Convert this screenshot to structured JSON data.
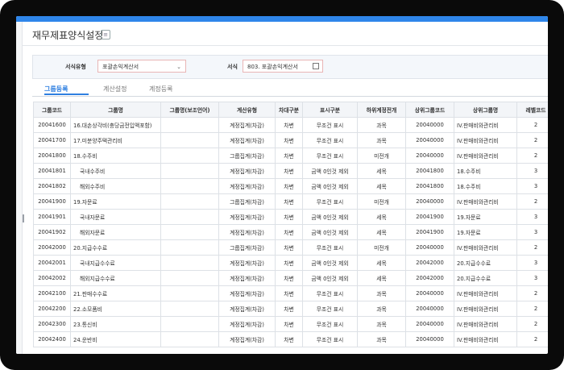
{
  "page_title": "재무제표양식설정",
  "filter": {
    "type_label": "서식유형",
    "type_value": "포괄손익계산서",
    "form_label": "서식",
    "form_value": "803. 포괄손익계산서"
  },
  "tabs": [
    "그룹등록",
    "계산설정",
    "계정등록"
  ],
  "columns": [
    "그룹코드",
    "그룹명",
    "그룹명(보조언어)",
    "계산유형",
    "차대구분",
    "표시구분",
    "하위계정전개",
    "상위그룹코드",
    "상위그룹명",
    "레벨코드"
  ],
  "rows": [
    {
      "code": "20041600",
      "name": "16.대손상각비(충당금전입액포함)",
      "sub": "",
      "calc": "계정집계(차감)",
      "dc": "차변",
      "disp": "무조건 표시",
      "expand": "과목",
      "pcode": "20040000",
      "pname": "IV.판매비와관리비",
      "level": "2",
      "indent": false
    },
    {
      "code": "20041700",
      "name": "17.미분양주택관리비",
      "sub": "",
      "calc": "계정집계(차감)",
      "dc": "차변",
      "disp": "무조건 표시",
      "expand": "과목",
      "pcode": "20040000",
      "pname": "IV.판매비와관리비",
      "level": "2",
      "indent": false
    },
    {
      "code": "20041800",
      "name": "18.수주비",
      "sub": "",
      "calc": "그룹집계(차감)",
      "dc": "차변",
      "disp": "무조건 표시",
      "expand": "미전개",
      "pcode": "20040000",
      "pname": "IV.판매비와관리비",
      "level": "2",
      "indent": false
    },
    {
      "code": "20041801",
      "name": "국내수주비",
      "sub": "",
      "calc": "계정집계(차감)",
      "dc": "차변",
      "disp": "금액 0인것 제외",
      "expand": "세목",
      "pcode": "20041800",
      "pname": "18.수주비",
      "level": "3",
      "indent": true
    },
    {
      "code": "20041802",
      "name": "해외수주비",
      "sub": "",
      "calc": "계정집계(차감)",
      "dc": "차변",
      "disp": "금액 0인것 제외",
      "expand": "세목",
      "pcode": "20041800",
      "pname": "18.수주비",
      "level": "3",
      "indent": true
    },
    {
      "code": "20041900",
      "name": "19.자문료",
      "sub": "",
      "calc": "그룹집계(차감)",
      "dc": "차변",
      "disp": "무조건 표시",
      "expand": "미전개",
      "pcode": "20040000",
      "pname": "IV.판매비와관리비",
      "level": "2",
      "indent": false
    },
    {
      "code": "20041901",
      "name": "국내자문료",
      "sub": "",
      "calc": "계정집계(차감)",
      "dc": "차변",
      "disp": "금액 0인것 제외",
      "expand": "세목",
      "pcode": "20041900",
      "pname": "19.자문료",
      "level": "3",
      "indent": true
    },
    {
      "code": "20041902",
      "name": "해외자문료",
      "sub": "",
      "calc": "계정집계(차감)",
      "dc": "차변",
      "disp": "금액 0인것 제외",
      "expand": "세목",
      "pcode": "20041900",
      "pname": "19.자문료",
      "level": "3",
      "indent": true
    },
    {
      "code": "20042000",
      "name": "20.지급수수료",
      "sub": "",
      "calc": "그룹집계(차감)",
      "dc": "차변",
      "disp": "무조건 표시",
      "expand": "미전개",
      "pcode": "20040000",
      "pname": "IV.판매비와관리비",
      "level": "2",
      "indent": false
    },
    {
      "code": "20042001",
      "name": "국내지급수수료",
      "sub": "",
      "calc": "계정집계(차감)",
      "dc": "차변",
      "disp": "금액 0인것 제외",
      "expand": "세목",
      "pcode": "20042000",
      "pname": "20.지급수수료",
      "level": "3",
      "indent": true
    },
    {
      "code": "20042002",
      "name": "해외지급수수료",
      "sub": "",
      "calc": "계정집계(차감)",
      "dc": "차변",
      "disp": "금액 0인것 제외",
      "expand": "세목",
      "pcode": "20042000",
      "pname": "20.지급수수료",
      "level": "3",
      "indent": true
    },
    {
      "code": "20042100",
      "name": "21.판매수수료",
      "sub": "",
      "calc": "계정집계(차감)",
      "dc": "차변",
      "disp": "무조건 표시",
      "expand": "과목",
      "pcode": "20040000",
      "pname": "IV.판매비와관리비",
      "level": "2",
      "indent": false
    },
    {
      "code": "20042200",
      "name": "22.소모품비",
      "sub": "",
      "calc": "계정집계(차감)",
      "dc": "차변",
      "disp": "무조건 표시",
      "expand": "과목",
      "pcode": "20040000",
      "pname": "IV.판매비와관리비",
      "level": "2",
      "indent": false
    },
    {
      "code": "20042300",
      "name": "23.통신비",
      "sub": "",
      "calc": "계정집계(차감)",
      "dc": "차변",
      "disp": "무조건 표시",
      "expand": "과목",
      "pcode": "20040000",
      "pname": "IV.판매비와관리비",
      "level": "2",
      "indent": false
    },
    {
      "code": "20042400",
      "name": "24.운반비",
      "sub": "",
      "calc": "계정집계(차감)",
      "dc": "차변",
      "disp": "무조건 표시",
      "expand": "과목",
      "pcode": "20040000",
      "pname": "IV.판매비와관리비",
      "level": "2",
      "indent": false
    }
  ]
}
